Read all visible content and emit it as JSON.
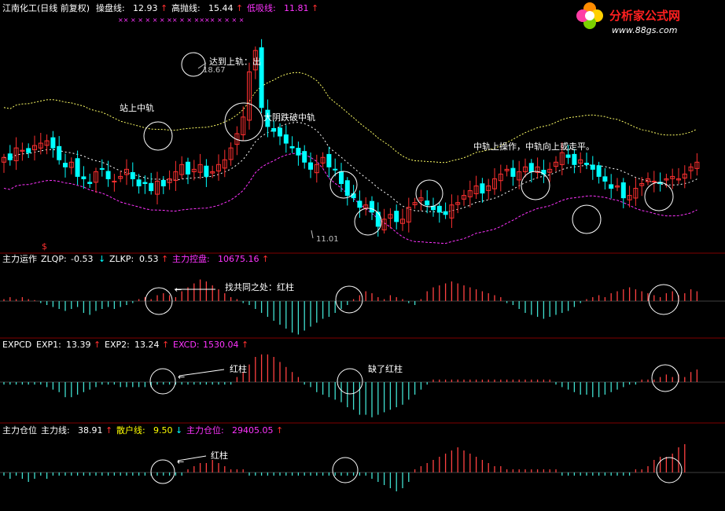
{
  "header": {
    "stock_title": "江南化工(日线 前复权)",
    "items": [
      {
        "label": "操盘线:",
        "value": "12.93",
        "color": "#ffffff",
        "arrow": "↑",
        "arrow_color": "#ff3030"
      },
      {
        "label": "高抛线:",
        "value": "15.44",
        "color": "#ffffff",
        "arrow": "↑",
        "arrow_color": "#ff3030"
      },
      {
        "label": "低吸线:",
        "value": "11.81",
        "color": "#ff33ff",
        "arrow": "↑",
        "arrow_color": "#ff3030"
      }
    ],
    "marker_row": "××  ×   ×   ×   ×         × ×× ×   ×     ××××   ×     ×   ×   ×"
  },
  "logo": {
    "name": "分析家公式网",
    "url": "www.88gs.com"
  },
  "price_panel": {
    "annotations": {
      "top_rail": "达到上轨：出",
      "high_value": "18.67",
      "mid_rail": "站上中轨",
      "break_mid": "大阴跌破中轨",
      "mid_rail_up": "中轨上操作，中轨向上或走平。",
      "low_value": "11.01",
      "dollar": "$"
    }
  },
  "panel2": {
    "title": "主力运作",
    "items": [
      {
        "label": "ZLQP:",
        "value": "-0.53",
        "color": "#ffffff",
        "arrow": "↓",
        "arrow_color": "#00ffff"
      },
      {
        "label": "ZLKP:",
        "value": "0.53",
        "color": "#ffffff",
        "arrow": "↑",
        "arrow_color": "#ff3030"
      },
      {
        "label": "主力控盘:",
        "value": "10675.16",
        "color": "#ff33ff",
        "arrow": "↑",
        "arrow_color": "#ff3030"
      }
    ],
    "note": "找共同之处：红柱"
  },
  "panel3": {
    "title": "EXPCD",
    "items": [
      {
        "label": "EXP1:",
        "value": "13.39",
        "color": "#ffffff",
        "arrow": "↑",
        "arrow_color": "#ff3030"
      },
      {
        "label": "EXP2:",
        "value": "13.24",
        "color": "#ffffff",
        "arrow": "↑",
        "arrow_color": "#ff3030"
      },
      {
        "label": "EXCD:",
        "value": "1530.04",
        "color": "#ff33ff",
        "arrow": "↑",
        "arrow_color": "#ff3030"
      }
    ],
    "note_red": "红柱",
    "note_missing": "缺了红柱"
  },
  "panel4": {
    "title": "主力仓位",
    "items": [
      {
        "label": "主力线:",
        "value": "38.91",
        "color": "#ffffff",
        "arrow": "↑",
        "arrow_color": "#ff3030"
      },
      {
        "label": "散户线:",
        "value": "9.50",
        "color": "#ffff00",
        "arrow": "↓",
        "arrow_color": "#00ffff"
      },
      {
        "label": "主力仓位:",
        "value": "29405.05",
        "color": "#ff33ff",
        "arrow": "↑",
        "arrow_color": "#ff3030"
      }
    ],
    "note": "红柱"
  },
  "chart_data": {
    "type": "candlestick",
    "n_bars": 114,
    "high": 18.67,
    "low": 11.01,
    "close_path": [
      13.9,
      13.8,
      14.3,
      14.2,
      14.1,
      14.4,
      14.5,
      14.6,
      14.3,
      13.8,
      13.5,
      13.7,
      13.1,
      13.0,
      12.8,
      13.3,
      13.4,
      13.0,
      12.9,
      13.1,
      13.4,
      13.0,
      12.7,
      12.8,
      12.5,
      12.9,
      12.7,
      13.0,
      13.3,
      13.6,
      13.2,
      13.4,
      13.6,
      13.1,
      13.3,
      13.6,
      13.8,
      14.3,
      14.9,
      15.6,
      17.5,
      18.4,
      16.0,
      15.2,
      15.0,
      14.8,
      14.5,
      14.3,
      14.0,
      13.7,
      13.4,
      13.6,
      13.9,
      13.5,
      13.4,
      12.8,
      12.3,
      12.2,
      11.8,
      11.9,
      11.6,
      11.0,
      11.3,
      11.5,
      11.2,
      11.3,
      11.8,
      12.0,
      12.2,
      11.9,
      11.7,
      11.6,
      11.5,
      11.9,
      12.0,
      12.3,
      12.5,
      12.7,
      12.4,
      12.7,
      13.0,
      13.2,
      13.4,
      13.1,
      13.3,
      13.5,
      13.3,
      13.5,
      13.2,
      13.4,
      13.7,
      14.1,
      13.9,
      13.6,
      13.8,
      13.6,
      13.4,
      13.1,
      12.9,
      12.6,
      12.7,
      12.2,
      12.3,
      12.6,
      12.8,
      13.0,
      12.9,
      12.8,
      13.0,
      13.1,
      13.0,
      13.2,
      13.5,
      13.7
    ],
    "up_color": "#ff3030",
    "down_color": "#00ffff",
    "upper_rail_color": "#ffff66",
    "middle_rail_color": "#ffffff",
    "lower_rail_color": "#ff33ff",
    "panel2_values": [
      1,
      2,
      1,
      2,
      1,
      0.5,
      -1,
      -2,
      -3,
      -4,
      -5,
      -4,
      -3,
      -6,
      -7,
      -5,
      -4,
      -3,
      -4,
      -3,
      -2,
      -1,
      1,
      2,
      1,
      3,
      4,
      3,
      2,
      5,
      7,
      9,
      11,
      10,
      8,
      6,
      4,
      2,
      1,
      -1,
      -2,
      -4,
      -6,
      -8,
      -10,
      -12,
      -14,
      -16,
      -17,
      -15,
      -13,
      -11,
      -9,
      -8,
      -6,
      -4,
      -2,
      1,
      3,
      5,
      4,
      2,
      1,
      3,
      2,
      1,
      -1,
      -2,
      1,
      5,
      7,
      8,
      9,
      10,
      9,
      8,
      7,
      6,
      5,
      4,
      3,
      2,
      -1,
      -2,
      -4,
      -6,
      -7,
      -8,
      -9,
      -8,
      -7,
      -6,
      -5,
      -3,
      -1,
      1,
      2,
      3,
      2,
      4,
      5,
      6,
      7,
      6,
      5,
      4,
      3,
      2,
      4,
      5,
      3,
      4,
      6,
      5
    ],
    "panel3_values": [
      -1,
      -1,
      -1,
      -1,
      -1,
      -1,
      -1,
      -2,
      -3,
      -4,
      -6,
      -6,
      -5,
      -4,
      -3,
      -2,
      -1,
      -1,
      -1,
      -2,
      -2,
      -2,
      -2,
      -2,
      -2,
      -1,
      -1,
      -1,
      -1,
      -1,
      -1,
      -1,
      -1,
      -1,
      -1,
      -1,
      -1,
      -1,
      2,
      4,
      7,
      10,
      11,
      11,
      10,
      8,
      6,
      4,
      2,
      -1,
      -2,
      -4,
      -5,
      -6,
      -7,
      -8,
      -10,
      -11,
      -13,
      -13,
      -14,
      -13,
      -12,
      -11,
      -10,
      -9,
      -7,
      -5,
      -3,
      -1,
      1,
      1,
      1,
      1,
      1,
      1,
      1,
      1,
      1,
      1,
      1,
      1,
      1,
      1,
      1,
      1,
      1,
      1,
      1,
      1,
      -1,
      -2,
      -3,
      -4,
      -5,
      -5,
      -6,
      -6,
      -5,
      -4,
      -3,
      -2,
      -1,
      -1,
      1,
      1,
      1,
      2,
      3,
      2,
      3,
      2,
      4,
      5
    ],
    "panel4_values": [
      -1,
      -2,
      -1,
      -2,
      -3,
      -2,
      -1,
      -2,
      -1,
      -1,
      -1,
      -1,
      -1,
      -1,
      -1,
      -1,
      -1,
      -1,
      -1,
      -1,
      -1,
      -1,
      -1,
      -1,
      -1,
      -1,
      -1,
      -1,
      -1,
      -1,
      1,
      2,
      3,
      3,
      4,
      3,
      2,
      1,
      1,
      1,
      -1,
      -1,
      -1,
      -1,
      -1,
      -1,
      -1,
      -1,
      -1,
      -1,
      -1,
      -1,
      -1,
      -1,
      -1,
      -1,
      -1,
      -1,
      -1,
      -1,
      -2,
      -3,
      -4,
      -5,
      -6,
      -5,
      -3,
      1,
      2,
      3,
      4,
      5,
      6,
      7,
      8,
      7,
      6,
      5,
      4,
      3,
      2,
      2,
      1,
      1,
      1,
      1,
      1,
      1,
      1,
      1,
      1,
      -1,
      -1,
      -1,
      -1,
      -1,
      -1,
      -1,
      -1,
      -1,
      -1,
      -1,
      -1,
      1,
      1,
      2,
      4,
      5,
      5,
      6,
      8,
      9
    ]
  }
}
